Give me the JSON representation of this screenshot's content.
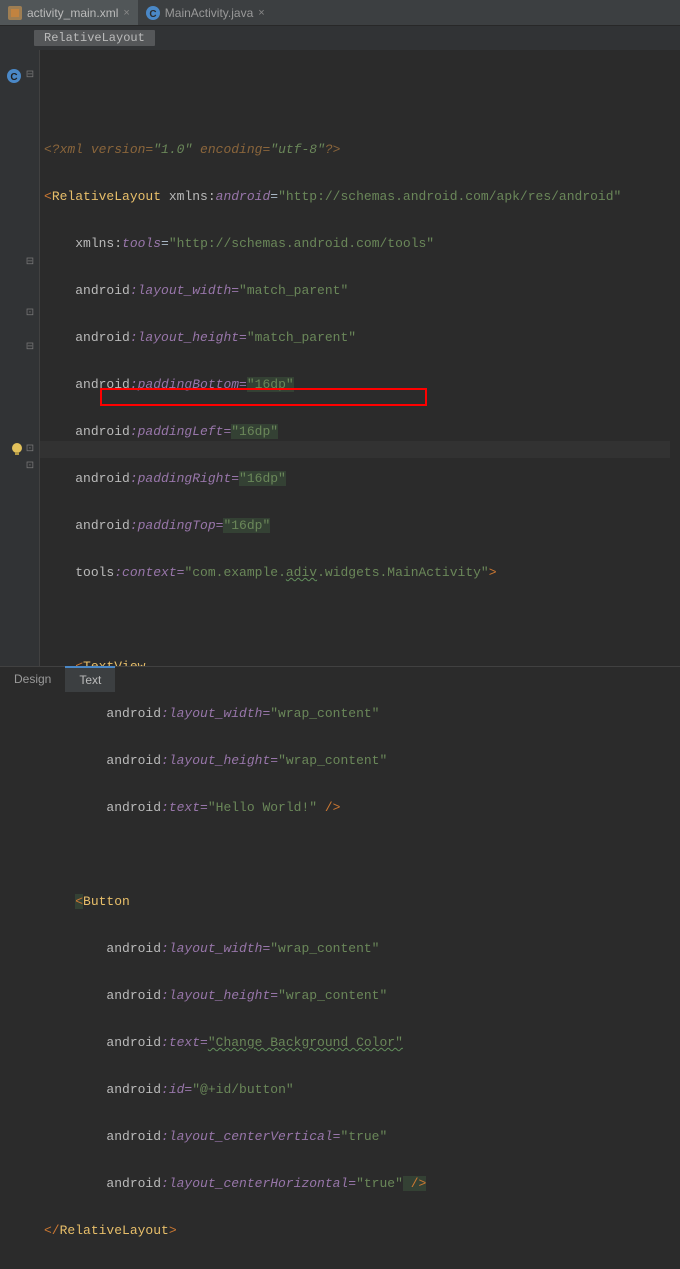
{
  "tabs": {
    "file1": {
      "name": "activity_main.xml"
    },
    "file2": {
      "name": "MainActivity.java"
    }
  },
  "breadcrumb": {
    "root": "RelativeLayout"
  },
  "code": {
    "l1": {
      "a": "<?",
      "b": "xml version=",
      "c": "\"1.0\"",
      "d": " encoding=",
      "e": "\"utf-8\"",
      "f": "?>"
    },
    "l2": {
      "a": "<",
      "b": "RelativeLayout ",
      "c": "xmlns:",
      "d": "android",
      "e": "=",
      "f": "\"http://schemas.android.com/apk/res/android\""
    },
    "l3": {
      "a": "xmlns:",
      "b": "tools",
      "c": "=",
      "d": "\"http://schemas.android.com/tools\""
    },
    "l4": {
      "a": "android",
      "b": ":layout_width=",
      "c": "\"match_parent\""
    },
    "l5": {
      "a": "android",
      "b": ":layout_height=",
      "c": "\"match_parent\""
    },
    "l6": {
      "a": "android",
      "b": ":paddingBottom=",
      "c": "\"16dp\""
    },
    "l7": {
      "a": "android",
      "b": ":paddingLeft=",
      "c": "\"16dp\""
    },
    "l8": {
      "a": "android",
      "b": ":paddingRight=",
      "c": "\"16dp\""
    },
    "l9": {
      "a": "android",
      "b": ":paddingTop=",
      "c": "\"16dp\""
    },
    "l10": {
      "a": "tools",
      "b": ":context=",
      "c": "\"com.example.",
      "d": "adiv",
      "e": ".widgets.MainActivity\"",
      "f": ">"
    },
    "l12": {
      "a": "<",
      "b": "TextView"
    },
    "l13": {
      "a": "android",
      "b": ":layout_width=",
      "c": "\"wrap_content\""
    },
    "l14": {
      "a": "android",
      "b": ":layout_height=",
      "c": "\"wrap_content\""
    },
    "l15": {
      "a": "android",
      "b": ":text=",
      "c": "\"Hello World!\"",
      "d": " />"
    },
    "l17": {
      "a": "<",
      "b": "Button"
    },
    "l18": {
      "a": "android",
      "b": ":layout_width=",
      "c": "\"wrap_content\""
    },
    "l19": {
      "a": "android",
      "b": ":layout_height=",
      "c": "\"wrap_content\""
    },
    "l20": {
      "a": "android",
      "b": ":text=",
      "c": "\"Change Background Color\""
    },
    "l21": {
      "a": "android",
      "b": ":id=",
      "c": "\"@+id/button\""
    },
    "l22": {
      "a": "android",
      "b": ":layout_centerVertical=",
      "c": "\"true\""
    },
    "l23": {
      "a": "android",
      "b": ":layout_centerHorizontal=",
      "c": "\"true\"",
      "d": " />"
    },
    "l24": {
      "a": "</",
      "b": "RelativeLayout",
      "c": ">"
    }
  },
  "bottom": {
    "design": "Design",
    "text": "Text"
  }
}
